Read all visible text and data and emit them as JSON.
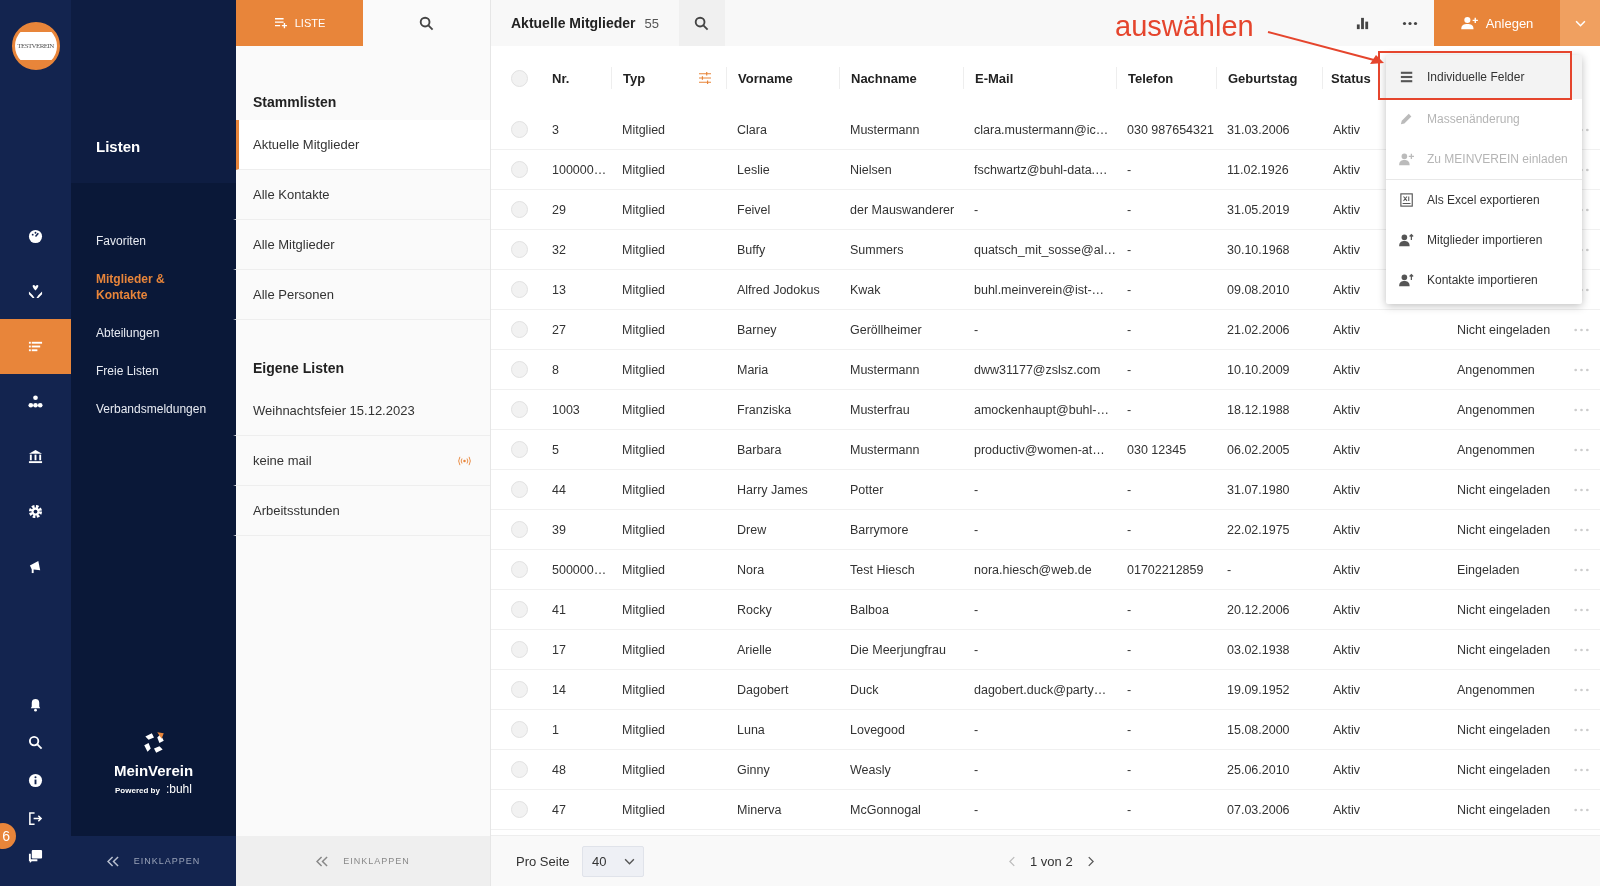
{
  "rail": {
    "logo": "TESTVEREIN",
    "badge": "6",
    "items": [
      {
        "kind": "gauge",
        "selected": false
      },
      {
        "kind": "hands",
        "selected": false
      },
      {
        "kind": "list",
        "selected": true
      },
      {
        "kind": "network",
        "selected": false
      },
      {
        "kind": "bank",
        "selected": false
      },
      {
        "kind": "gear",
        "selected": false
      },
      {
        "kind": "megaphone",
        "selected": false
      }
    ],
    "bottom": [
      {
        "kind": "bell"
      },
      {
        "kind": "search"
      },
      {
        "kind": "info"
      },
      {
        "kind": "logout"
      },
      {
        "kind": "help"
      }
    ]
  },
  "nav": {
    "title": "Listen",
    "items": [
      {
        "label": "Favoriten",
        "selected": false
      },
      {
        "label": "Mitglieder & Kontakte",
        "selected": true
      },
      {
        "label": "Abteilungen",
        "selected": false
      },
      {
        "label": "Freie Listen",
        "selected": false
      },
      {
        "label": "Verbandsmeldungen",
        "selected": false
      }
    ],
    "brand": "MeinVerein",
    "powered_by": "Powered by",
    "powered_brand": ":buhl",
    "collapse": "EINKLAPPEN"
  },
  "lists": {
    "tab": "LISTE",
    "sections": [
      {
        "title": "Stammlisten",
        "items": [
          {
            "label": "Aktuelle Mitglieder",
            "selected": true,
            "live": false
          },
          {
            "label": "Alle Kontakte",
            "selected": false,
            "live": false
          },
          {
            "label": "Alle Mitglieder",
            "selected": false,
            "live": false
          },
          {
            "label": "Alle Personen",
            "selected": false,
            "live": false
          }
        ]
      },
      {
        "title": "Eigene Listen",
        "items": [
          {
            "label": "Weihnachtsfeier 15.12.2023",
            "selected": false,
            "live": false
          },
          {
            "label": "keine mail",
            "selected": false,
            "live": true
          },
          {
            "label": "Arbeitsstunden",
            "selected": false,
            "live": false
          }
        ]
      }
    ],
    "collapse": "EINKLAPPEN"
  },
  "main": {
    "title": "Aktuelle Mitglieder",
    "count": "55",
    "create": "Anlegen",
    "all_selected": false,
    "columns": [
      {
        "label": "Nr.",
        "filterable": false
      },
      {
        "label": "Typ",
        "filterable": true
      },
      {
        "label": "Vorname",
        "filterable": false
      },
      {
        "label": "Nachname",
        "filterable": false
      },
      {
        "label": "E-Mail",
        "filterable": false
      },
      {
        "label": "Telefon",
        "filterable": false
      },
      {
        "label": "Geburtstag",
        "filterable": false
      },
      {
        "label": "Status",
        "filterable": false
      }
    ],
    "rows": [
      {
        "selected": false,
        "nr": "3",
        "typ": "Mitglied",
        "vorname": "Clara",
        "nachname": "Mustermann",
        "email": "clara.mustermann@ic…",
        "telefon": "030 987654321",
        "geburtstag": "31.03.2006",
        "status": "Aktiv"
      },
      {
        "selected": false,
        "nr": "100000…",
        "typ": "Mitglied",
        "vorname": "Leslie",
        "nachname": "Nielsen",
        "email": "fschwartz@buhl-data.…",
        "telefon": "-",
        "geburtstag": "11.02.1926",
        "status": "Aktiv"
      },
      {
        "selected": false,
        "nr": "29",
        "typ": "Mitglied",
        "vorname": "Feivel",
        "nachname": "der Mauswanderer",
        "email": "-",
        "telefon": "-",
        "geburtstag": "31.05.2019",
        "status": "Aktiv"
      },
      {
        "selected": false,
        "nr": "32",
        "typ": "Mitglied",
        "vorname": "Buffy",
        "nachname": "Summers",
        "email": "quatsch_mit_sosse@al…",
        "telefon": "-",
        "geburtstag": "30.10.1968",
        "status": "Aktiv"
      },
      {
        "selected": false,
        "nr": "13",
        "typ": "Mitglied",
        "vorname": "Alfred Jodokus",
        "nachname": "Kwak",
        "email": "buhl.meinverein@ist-…",
        "telefon": "-",
        "geburtstag": "09.08.2010",
        "status": "Aktiv"
      },
      {
        "selected": false,
        "nr": "27",
        "typ": "Mitglied",
        "vorname": "Barney",
        "nachname": "Geröllheimer",
        "email": "-",
        "telefon": "-",
        "geburtstag": "21.02.2006",
        "status": "Aktiv",
        "einladung": "Nicht eingeladen"
      },
      {
        "selected": false,
        "nr": "8",
        "typ": "Mitglied",
        "vorname": "Maria",
        "nachname": "Mustermann",
        "email": "dww31177@zslsz.com",
        "telefon": "-",
        "geburtstag": "10.10.2009",
        "status": "Aktiv",
        "einladung": "Angenommen"
      },
      {
        "selected": false,
        "nr": "1003",
        "typ": "Mitglied",
        "vorname": "Franziska",
        "nachname": "Musterfrau",
        "email": "amockenhaupt@buhl-…",
        "telefon": "-",
        "geburtstag": "18.12.1988",
        "status": "Aktiv",
        "einladung": "Angenommen"
      },
      {
        "selected": false,
        "nr": "5",
        "typ": "Mitglied",
        "vorname": "Barbara",
        "nachname": "Mustermann",
        "email": "productiv@women-at…",
        "telefon": "030 12345",
        "geburtstag": "06.02.2005",
        "status": "Aktiv",
        "einladung": "Angenommen"
      },
      {
        "selected": false,
        "nr": "44",
        "typ": "Mitglied",
        "vorname": "Harry James",
        "nachname": "Potter",
        "email": "-",
        "telefon": "-",
        "geburtstag": "31.07.1980",
        "status": "Aktiv",
        "einladung": "Nicht eingeladen"
      },
      {
        "selected": false,
        "nr": "39",
        "typ": "Mitglied",
        "vorname": "Drew",
        "nachname": "Barrymore",
        "email": "-",
        "telefon": "-",
        "geburtstag": "22.02.1975",
        "status": "Aktiv",
        "einladung": "Nicht eingeladen"
      },
      {
        "selected": false,
        "nr": "500000…",
        "typ": "Mitglied",
        "vorname": "Nora",
        "nachname": "Test Hiesch",
        "email": "nora.hiesch@web.de",
        "telefon": "01702212859",
        "geburtstag": "-",
        "status": "Aktiv",
        "einladung": "Eingeladen"
      },
      {
        "selected": false,
        "nr": "41",
        "typ": "Mitglied",
        "vorname": "Rocky",
        "nachname": "Balboa",
        "email": "-",
        "telefon": "-",
        "geburtstag": "20.12.2006",
        "status": "Aktiv",
        "einladung": "Nicht eingeladen"
      },
      {
        "selected": false,
        "nr": "17",
        "typ": "Mitglied",
        "vorname": "Arielle",
        "nachname": "Die Meerjungfrau",
        "email": "-",
        "telefon": "-",
        "geburtstag": "03.02.1938",
        "status": "Aktiv",
        "einladung": "Nicht eingeladen"
      },
      {
        "selected": false,
        "nr": "14",
        "typ": "Mitglied",
        "vorname": "Dagobert",
        "nachname": "Duck",
        "email": "dagobert.duck@party…",
        "telefon": "-",
        "geburtstag": "19.09.1952",
        "status": "Aktiv",
        "einladung": "Angenommen"
      },
      {
        "selected": false,
        "nr": "1",
        "typ": "Mitglied",
        "vorname": "Luna",
        "nachname": "Lovegood",
        "email": "-",
        "telefon": "-",
        "geburtstag": "15.08.2000",
        "status": "Aktiv",
        "einladung": "Nicht eingeladen"
      },
      {
        "selected": false,
        "nr": "48",
        "typ": "Mitglied",
        "vorname": "Ginny",
        "nachname": "Weasly",
        "email": "-",
        "telefon": "-",
        "geburtstag": "25.06.2010",
        "status": "Aktiv",
        "einladung": "Nicht eingeladen"
      },
      {
        "selected": false,
        "nr": "47",
        "typ": "Mitglied",
        "vorname": "Minerva",
        "nachname": "McGonnogal",
        "email": "-",
        "telefon": "-",
        "geburtstag": "07.03.2006",
        "status": "Aktiv",
        "einladung": "Nicht eingeladen"
      }
    ],
    "footer": {
      "per_page_label": "Pro Seite",
      "per_page": "40",
      "page": "1 von 2"
    }
  },
  "menu": [
    {
      "label": "Individuelle Felder",
      "kind": "fields",
      "selected": true,
      "disabled": false,
      "separated": false
    },
    {
      "label": "Massenänderung",
      "kind": "pencil",
      "selected": false,
      "disabled": true,
      "separated": false
    },
    {
      "label": "Zu MEINVEREIN einladen",
      "kind": "userplus",
      "selected": false,
      "disabled": true,
      "separated": false
    },
    {
      "label": "Als Excel exportieren",
      "kind": "excel",
      "selected": false,
      "disabled": false,
      "separated": true
    },
    {
      "label": "Mitglieder importieren",
      "kind": "userup",
      "selected": false,
      "disabled": false,
      "separated": false
    },
    {
      "label": "Kontakte importieren",
      "kind": "userup",
      "selected": false,
      "disabled": false,
      "separated": false
    }
  ],
  "annotation": {
    "text": "auswählen"
  }
}
